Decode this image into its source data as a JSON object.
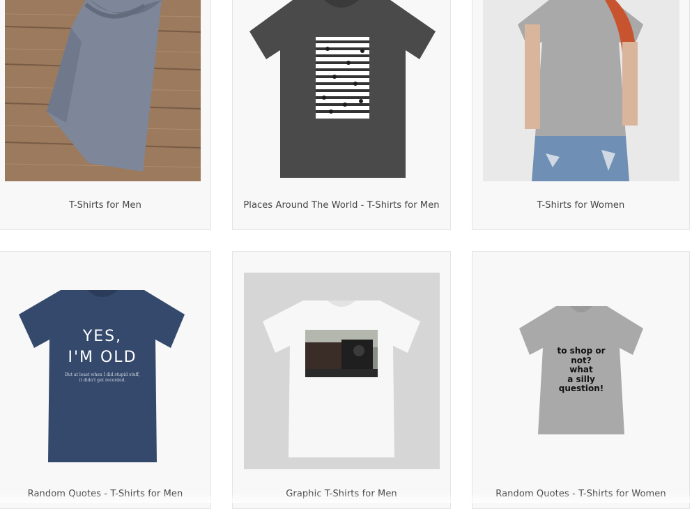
{
  "products": [
    {
      "title": "T-Shirts for Men"
    },
    {
      "title": "Places Around The World - T-Shirts for Men"
    },
    {
      "title": "T-Shirts for Women"
    },
    {
      "title": "Random Quotes - T-Shirts for Men",
      "shirt_text": "YES,",
      "shirt_text2": "I'M OLD",
      "shirt_small1": "But at least when I did stupid stuff,",
      "shirt_small2": "it didn't get recorded."
    },
    {
      "title": "Graphic T-Shirts for Men"
    },
    {
      "title": "Random Quotes - T-Shirts for Women",
      "shirt_lines": [
        "to shop or",
        "not?",
        "what",
        "a silly",
        "question!"
      ]
    }
  ],
  "colors": {
    "card_bg": "#f8f8f8",
    "card_border": "#e4e4e4",
    "label_text": "#444444",
    "navy_shirt": "#34496b",
    "charcoal_shirt": "#4a4a4a",
    "heather_grey_shirt": "#a9a9a9"
  }
}
